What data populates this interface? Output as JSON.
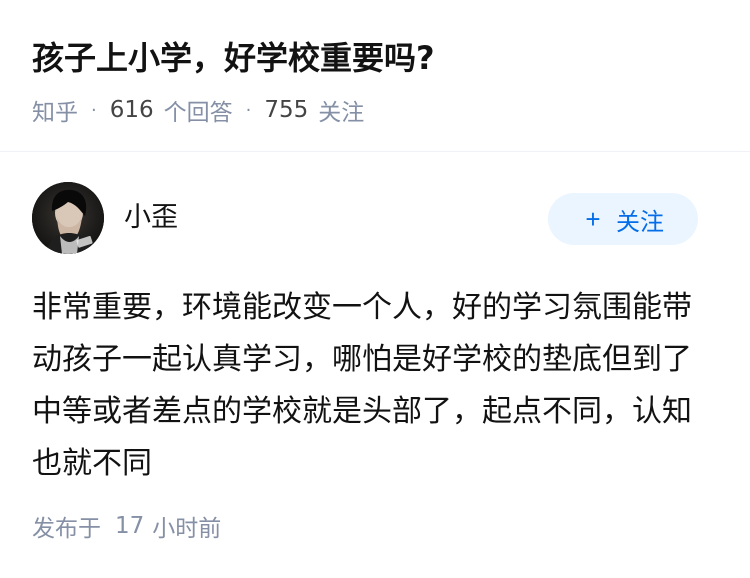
{
  "question": {
    "title": "孩子上小学，好学校重要吗?",
    "source": "知乎",
    "answer_count": "616",
    "answer_label": "个回答",
    "follower_count": "755",
    "follower_label": "关注",
    "separator": "·"
  },
  "answer": {
    "author_name": "小歪",
    "avatar_icon": "user-avatar-photo",
    "follow_button": {
      "icon": "plus-icon",
      "icon_glyph": "+",
      "label": "关注"
    },
    "content": "非常重要，环境能改变一个人，好的学习氛围能带动孩子一起认真学习，哪怕是好学校的垫底但到了中等或者差点的学校就是头部了，起点不同，认知也就不同",
    "published_label": "发布于",
    "published_time_value": "17",
    "published_time_unit": "小时前"
  },
  "colors": {
    "text_primary": "#121212",
    "text_secondary": "#8590a6",
    "follow_button_bg": "#ebf5ff",
    "follow_button_text": "#056de8",
    "divider": "#f0f2f7"
  }
}
